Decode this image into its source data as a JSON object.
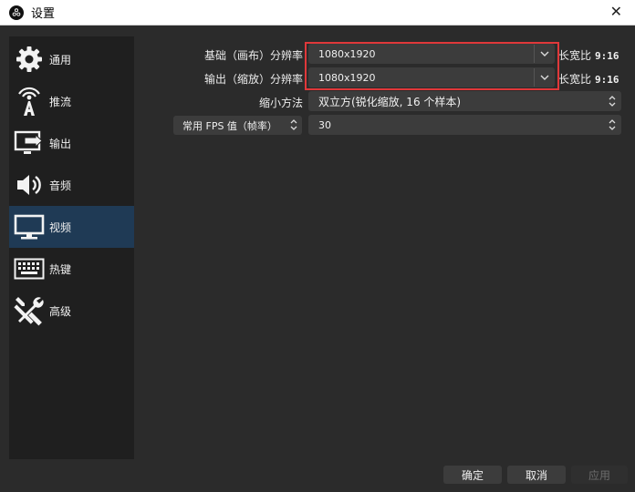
{
  "window": {
    "title": "设置"
  },
  "sidebar": {
    "items": [
      {
        "label": "通用",
        "icon": "gear-icon"
      },
      {
        "label": "推流",
        "icon": "broadcast-icon"
      },
      {
        "label": "输出",
        "icon": "output-icon"
      },
      {
        "label": "音频",
        "icon": "speaker-icon"
      },
      {
        "label": "视频",
        "icon": "monitor-icon",
        "active": true
      },
      {
        "label": "热键",
        "icon": "keyboard-icon"
      },
      {
        "label": "高级",
        "icon": "tools-icon"
      }
    ]
  },
  "video": {
    "base_resolution": {
      "label": "基础（画布）分辨率",
      "value": "1080x1920",
      "aspect_label": "长宽比",
      "aspect_value": "9:16"
    },
    "output_resolution": {
      "label": "输出（缩放）分辨率",
      "value": "1080x1920",
      "aspect_label": "长宽比",
      "aspect_value": "9:16"
    },
    "downscale_filter": {
      "label": "缩小方法",
      "value": "双立方(锐化缩放, 16 个样本)"
    },
    "fps": {
      "type_label": "常用 FPS 值（帧率）",
      "value": "30"
    }
  },
  "buttons": {
    "ok": "确定",
    "cancel": "取消",
    "apply": "应用"
  },
  "colors": {
    "highlight": "#e0383a",
    "active_nav": "#1f3a55"
  }
}
